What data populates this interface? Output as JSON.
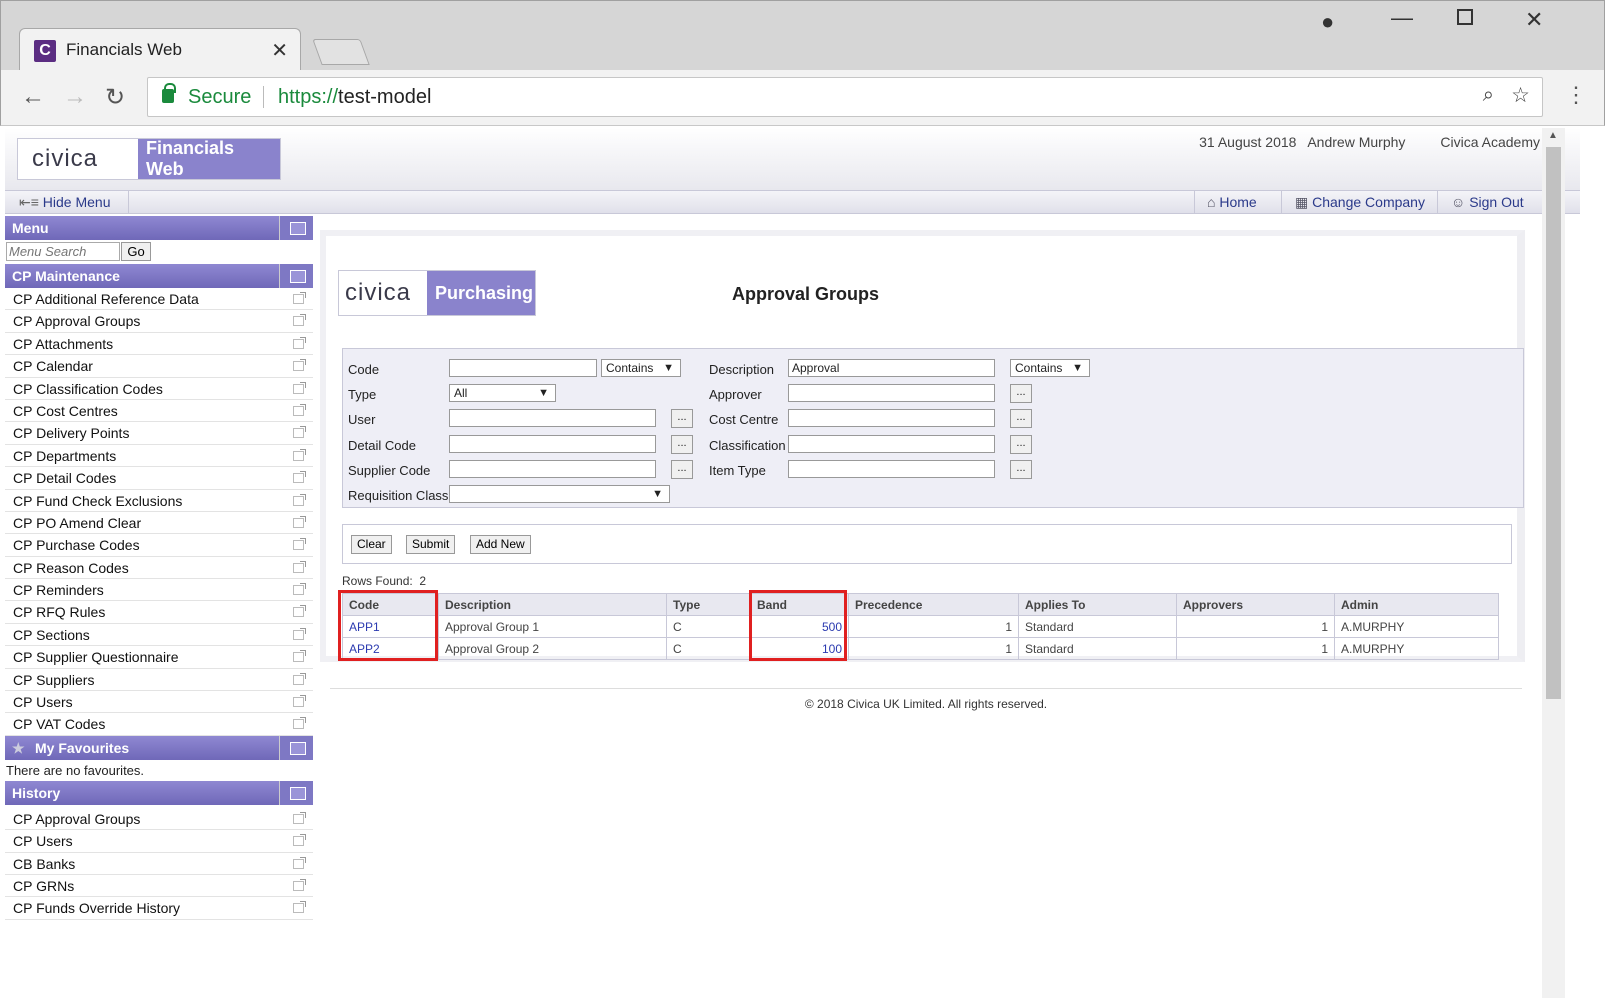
{
  "browser": {
    "tab_title": "Financials Web",
    "url_scheme": "https://",
    "url_host": "test-model",
    "secure_label": "Secure"
  },
  "header": {
    "brand_left": "civica",
    "brand_right": "Financials Web",
    "date": "31 August 2018",
    "user": "Andrew Murphy",
    "org": "Civica Academy"
  },
  "menubar": {
    "hide_menu": "Hide Menu",
    "home": "Home",
    "change_company": "Change Company",
    "sign_out": "Sign Out"
  },
  "sidebar": {
    "menu_title": "Menu",
    "search_placeholder": "Menu Search",
    "go": "Go",
    "section_title": "CP Maintenance",
    "items": [
      "CP Additional Reference Data",
      "CP Approval Groups",
      "CP Attachments",
      "CP Calendar",
      "CP Classification Codes",
      "CP Cost Centres",
      "CP Delivery Points",
      "CP Departments",
      "CP Detail Codes",
      "CP Fund Check Exclusions",
      "CP PO Amend Clear",
      "CP Purchase Codes",
      "CP Reason Codes",
      "CP Reminders",
      "CP RFQ Rules",
      "CP Sections",
      "CP Supplier Questionnaire",
      "CP Suppliers",
      "CP Users",
      "CP VAT Codes"
    ],
    "favourites_title": "My Favourites",
    "favourites_empty": "There are no favourites.",
    "history_title": "History",
    "history": [
      "CP Approval Groups",
      "CP Users",
      "CB Banks",
      "CP GRNs",
      "CP Funds Override History"
    ]
  },
  "content": {
    "brand_left": "civica",
    "brand_right": "Purchasing",
    "title": "Approval Groups",
    "filter": {
      "code_label": "Code",
      "code_value": "",
      "code_mode": "Contains",
      "description_label": "Description",
      "description_value": "Approval",
      "description_mode": "Contains",
      "type_label": "Type",
      "type_value": "All",
      "approver_label": "Approver",
      "user_label": "User",
      "cost_centre_label": "Cost Centre",
      "detail_code_label": "Detail Code",
      "classification_label": "Classification",
      "supplier_code_label": "Supplier Code",
      "item_type_label": "Item Type",
      "requisition_class_label": "Requisition Class",
      "lookup": "..."
    },
    "buttons": {
      "clear": "Clear",
      "submit": "Submit",
      "add_new": "Add New"
    },
    "rows_found_label": "Rows Found:",
    "rows_found": "2",
    "columns": [
      "Code",
      "Description",
      "Type",
      "Band",
      "Precedence",
      "Applies To",
      "Approvers",
      "Admin"
    ],
    "rows": [
      {
        "code": "APP1",
        "description": "Approval Group 1",
        "type": "C",
        "band": "500",
        "precedence": "1",
        "applies_to": "Standard",
        "approvers": "1",
        "admin": "A.MURPHY"
      },
      {
        "code": "APP2",
        "description": "Approval Group 2",
        "type": "C",
        "band": "100",
        "precedence": "1",
        "applies_to": "Standard",
        "approvers": "1",
        "admin": "A.MURPHY"
      }
    ]
  },
  "footer": "© 2018 Civica UK Limited. All rights reserved."
}
